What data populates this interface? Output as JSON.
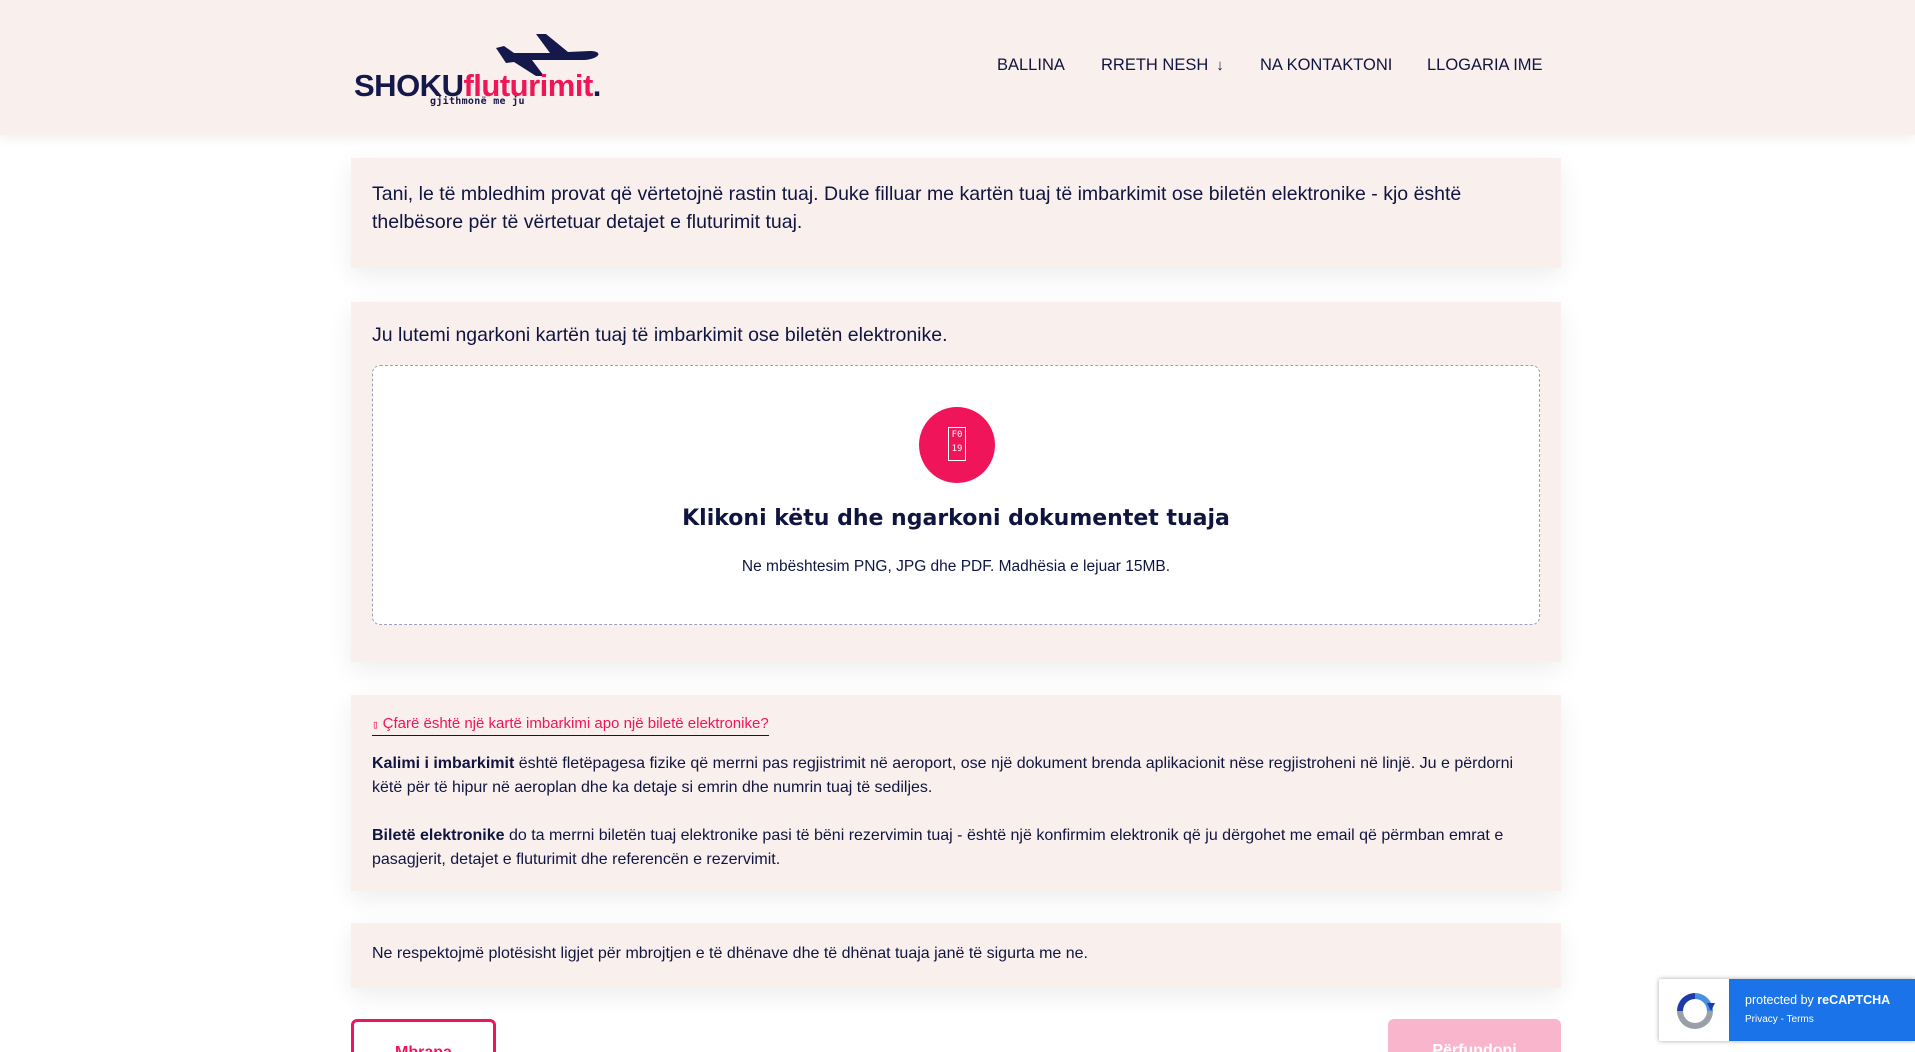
{
  "brand": {
    "name_part1": "SHOKU",
    "name_part2": "fluturimit",
    "name_part3": ".",
    "tagline": "gjithmonë me ju"
  },
  "nav": {
    "items": [
      {
        "label": "BALLINA"
      },
      {
        "label": "RRETH NESH"
      },
      {
        "label": "NA KONTAKTONI"
      },
      {
        "label": "LLOGARIA IME"
      }
    ]
  },
  "intro": {
    "text": "Tani, le të mbledhim provat që vërtetojnë rastin tuaj. Duke filluar me kartën tuaj të imbarkimit ose biletën elektronike - kjo është thelbësore për të vërtetuar detajet e fluturimit tuaj."
  },
  "upload": {
    "title": "Ju lutemi ngarkoni kartën tuaj të imbarkimit ose biletën elektronike.",
    "icon_glyph": [
      "F0",
      "19"
    ],
    "dropzone_heading": "Klikoni këtu dhe ngarkoni dokumentet tuaja",
    "dropzone_sub": "Ne mbështesim PNG, JPG dhe PDF. Madhësia e lejuar 15MB."
  },
  "info": {
    "link_text": "Çfarë është një kartë imbarkimi apo një biletë elektronike?",
    "p1_bold": "Kalimi i imbarkimit",
    "p1_text": " është fletëpagesa fizike që merrni pas regjistrimit në aeroport, ose një dokument brenda aplikacionit nëse regjistroheni në linjë. Ju e përdorni këtë për të hipur në aeroplan dhe ka detaje si emrin dhe numrin tuaj të sediljes.",
    "p2_bold": "Biletë elektronike",
    "p2_text": " do ta merrni biletën tuaj elektronike pasi të bëni rezervimin tuaj - është një konfirmim elektronik që ju dërgohet me email që përmban emrat e pasagjerit, detajet e fluturimit dhe referencën e rezervimit."
  },
  "privacy": {
    "text": "Ne respektojmë plotësisht ligjet për mbrojtjen e të dhënave dhe të dhënat tuaja janë të sigurta me ne."
  },
  "buttons": {
    "back": "Mbrapa",
    "finish": "Përfundoni"
  },
  "recaptcha": {
    "protected_by": "protected by",
    "brand": "reCAPTCHA",
    "privacy": "Privacy",
    "separator": " - ",
    "terms": "Terms"
  },
  "colors": {
    "accent": "#f0145a",
    "navy": "#101540",
    "card_bg": "#f9efec",
    "finish_disabled": "#f8b5cc",
    "recaptcha_blue": "#1a73e8"
  }
}
